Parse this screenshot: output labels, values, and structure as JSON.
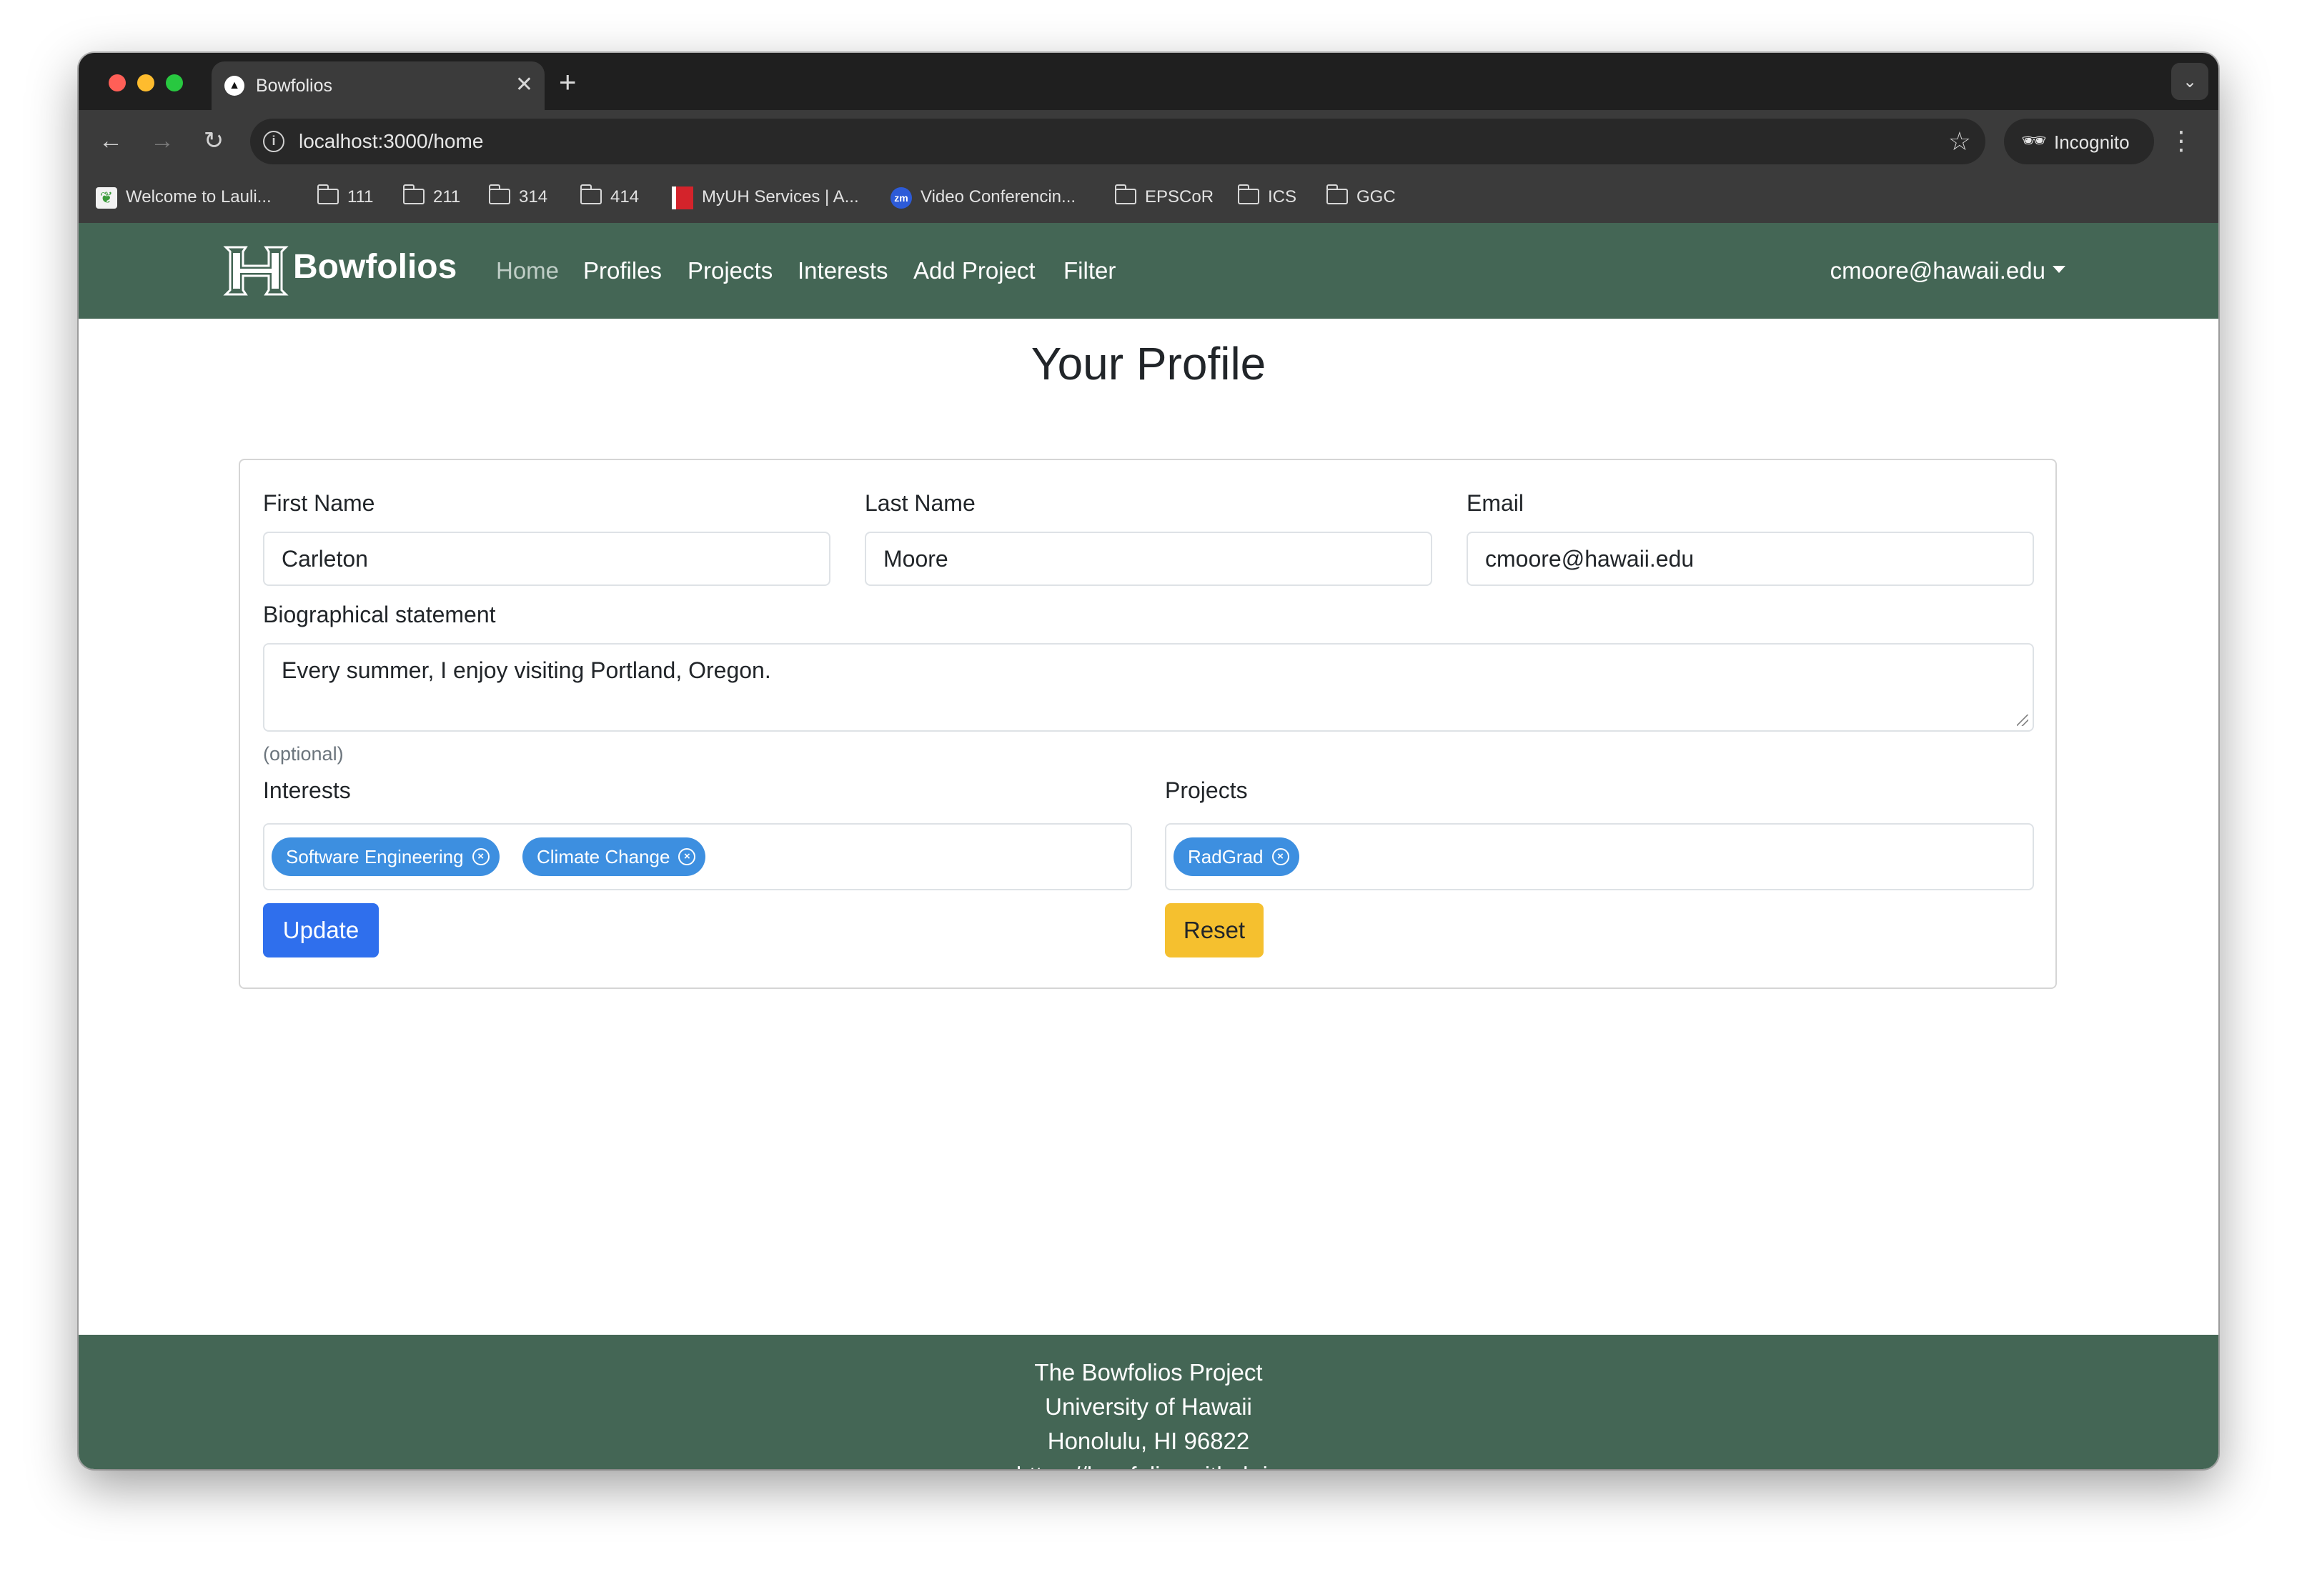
{
  "browser": {
    "tab_title": "Bowfolios",
    "url": "localhost:3000/home",
    "incognito_label": "Incognito",
    "bookmarks": [
      {
        "label": "Welcome to Lauli...",
        "icon": "leaf-icon"
      },
      {
        "label": "111",
        "icon": "folder-icon"
      },
      {
        "label": "211",
        "icon": "folder-icon"
      },
      {
        "label": "314",
        "icon": "folder-icon"
      },
      {
        "label": "414",
        "icon": "folder-icon"
      },
      {
        "label": "MyUH Services | A...",
        "icon": "myuh-icon"
      },
      {
        "label": "Video Conferencin...",
        "icon": "zoom-icon"
      },
      {
        "label": "EPSCoR",
        "icon": "folder-icon"
      },
      {
        "label": "ICS",
        "icon": "folder-icon"
      },
      {
        "label": "GGC",
        "icon": "folder-icon"
      }
    ]
  },
  "navbar": {
    "brand": "Bowfolios",
    "links": [
      "Home",
      "Profiles",
      "Projects",
      "Interests",
      "Add Project",
      "Filter"
    ],
    "active_link": "Home",
    "user": "cmoore@hawaii.edu",
    "color": "#446655"
  },
  "profile": {
    "title": "Your Profile",
    "first_name_label": "First Name",
    "first_name": "Carleton",
    "last_name_label": "Last Name",
    "last_name": "Moore",
    "email_label": "Email",
    "email": "cmoore@hawaii.edu",
    "bio_label": "Biographical statement",
    "bio": "Every summer, I enjoy visiting Portland, Oregon.",
    "bio_help": "(optional)",
    "interests_label": "Interests",
    "interests": [
      "Software Engineering",
      "Climate Change"
    ],
    "projects_label": "Projects",
    "projects": [
      "RadGrad"
    ],
    "update_label": "Update",
    "reset_label": "Reset",
    "chip_color": "#3d8fe0",
    "update_color": "#2f6fed",
    "reset_color": "#f5c02f"
  },
  "footer": {
    "line1": "The Bowfolios Project",
    "line2": "University of Hawaii",
    "line3": "Honolulu, HI 96822",
    "link": "https://bowfolios.github.io"
  }
}
